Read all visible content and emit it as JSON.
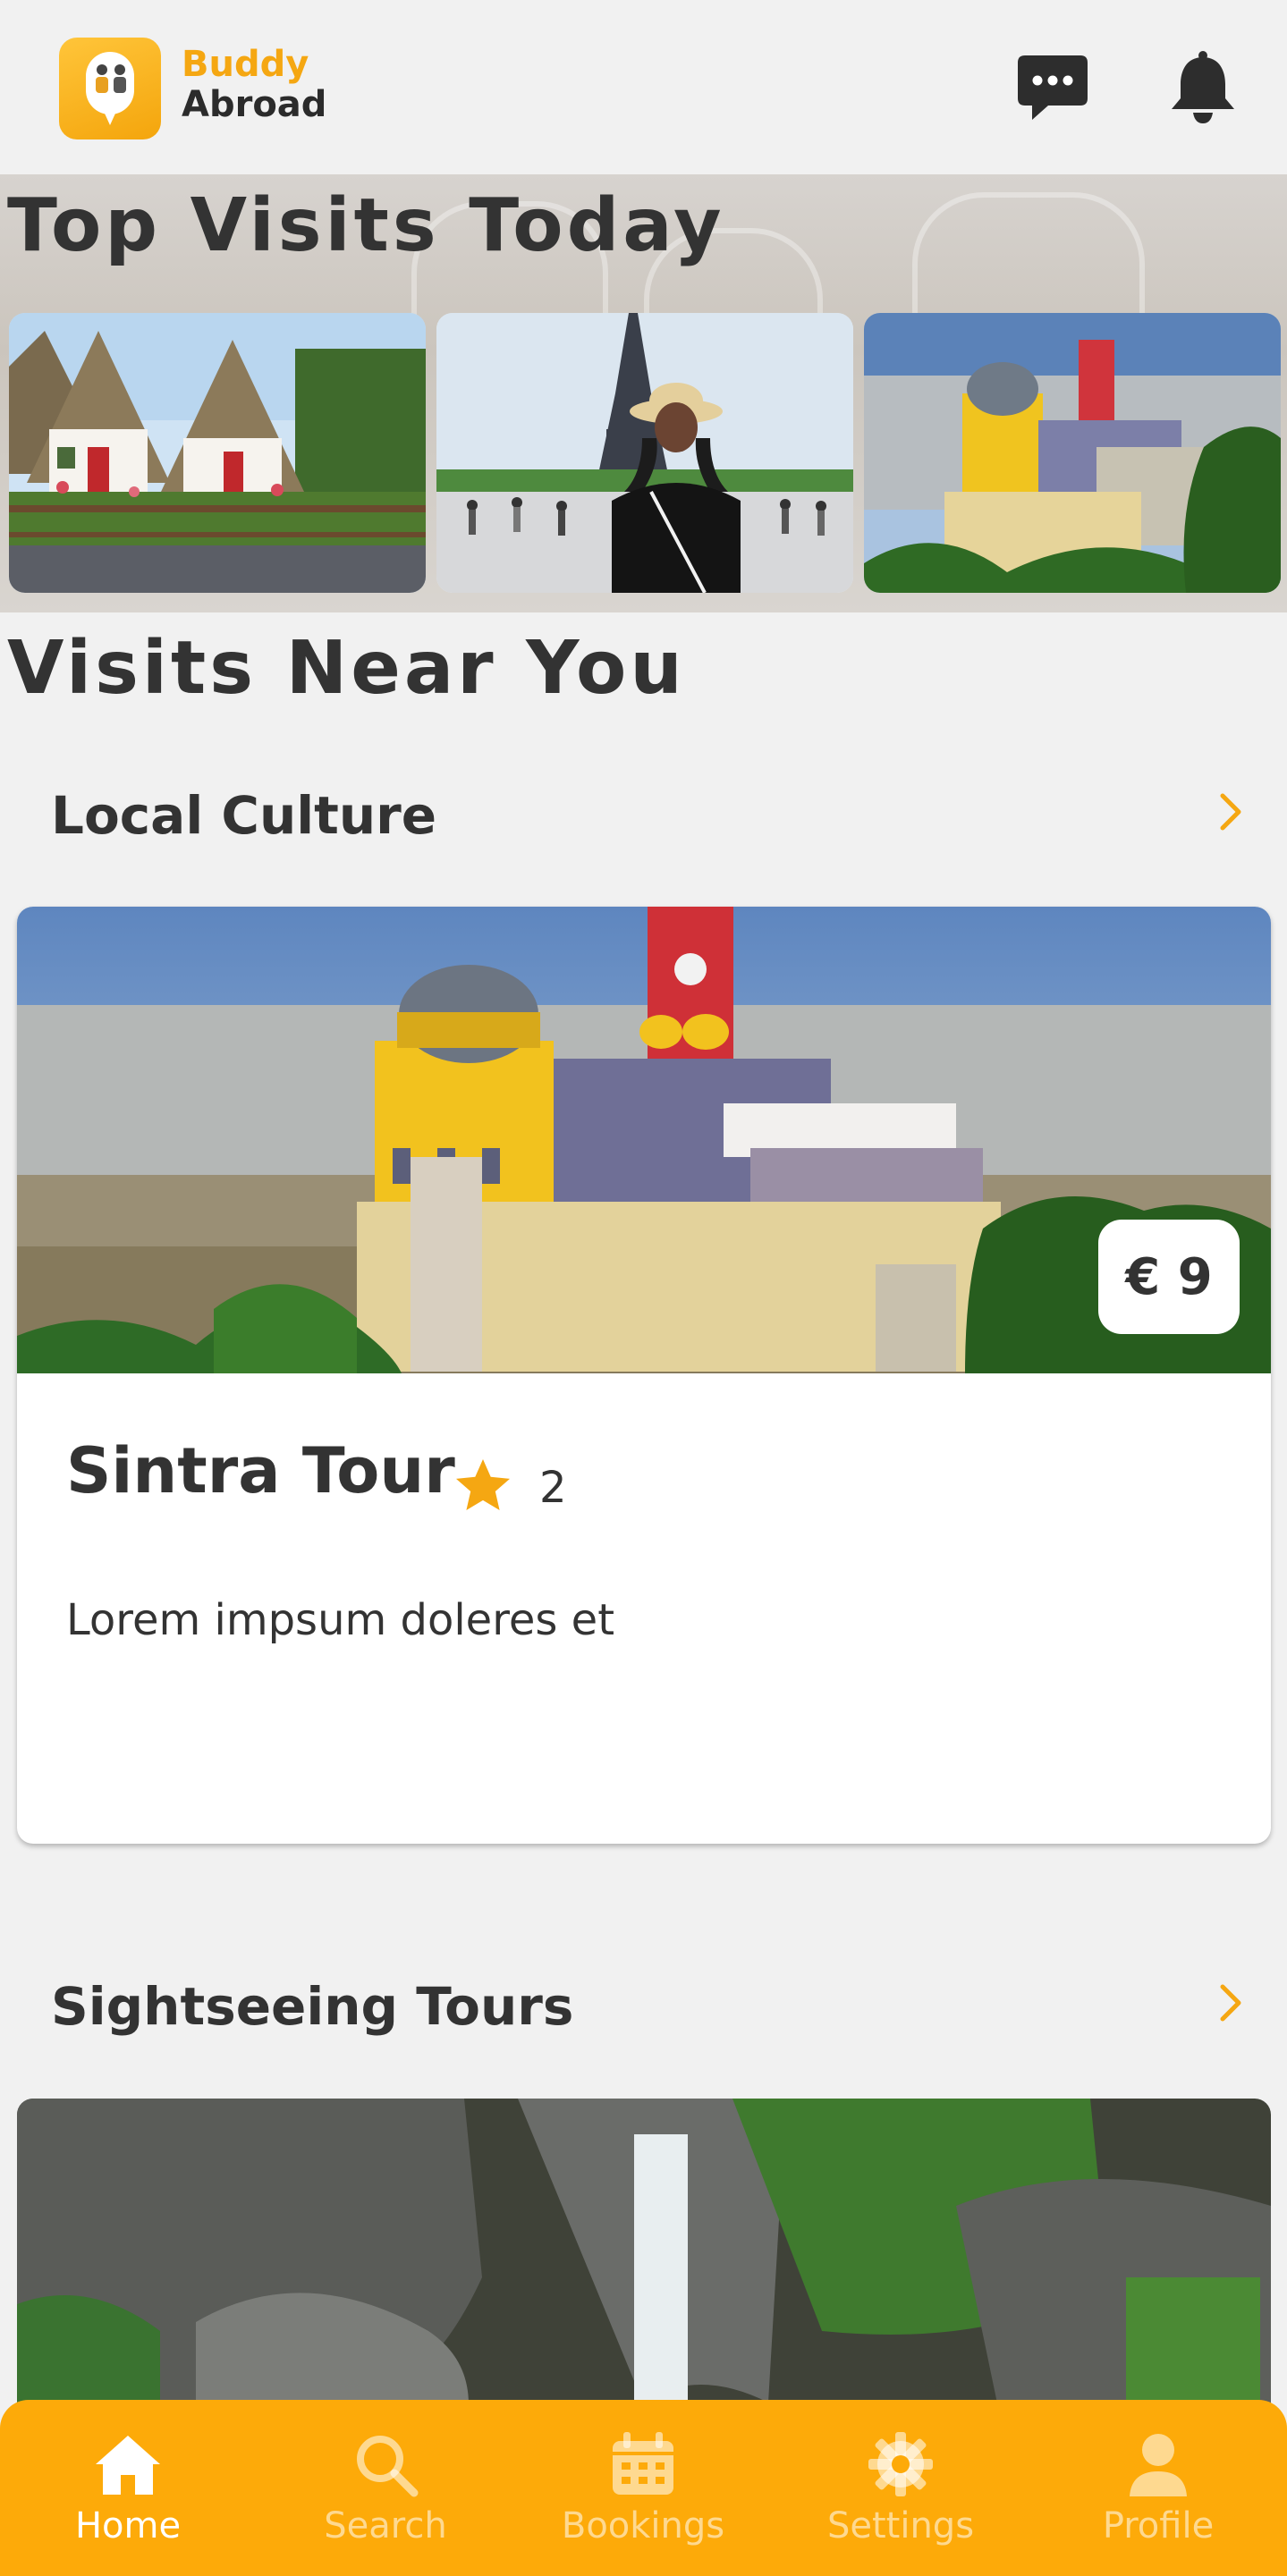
{
  "app": {
    "brand_line1": "Buddy",
    "brand_line2": "Abroad",
    "accent_color": "#fdaa09"
  },
  "header": {
    "icons": [
      "chat-icon",
      "bell-icon"
    ]
  },
  "top_visits": {
    "title": "Top Visits Today",
    "thumbnails": [
      "madeira-houses",
      "eiffel-tower-tourist",
      "pena-palace"
    ]
  },
  "visits_near": {
    "title": "Visits Near You"
  },
  "categories": [
    {
      "title": "Local Culture",
      "card": {
        "title": "Sintra Tour",
        "rating": "2",
        "price": "€ 9",
        "description": "Lorem impsum doleres et"
      }
    },
    {
      "title": "Sightseeing Tours"
    }
  ],
  "bottom_nav": {
    "items": [
      {
        "label": "Home",
        "icon": "home-icon",
        "active": true
      },
      {
        "label": "Search",
        "icon": "search-icon",
        "active": false
      },
      {
        "label": "Bookings",
        "icon": "calendar-icon",
        "active": false
      },
      {
        "label": "Settings",
        "icon": "gear-icon",
        "active": false
      },
      {
        "label": "Profile",
        "icon": "user-icon",
        "active": false
      }
    ]
  }
}
